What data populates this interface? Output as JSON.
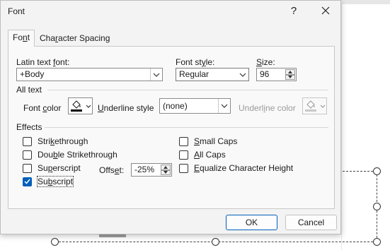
{
  "dialog": {
    "title": "Font",
    "help_label": "?",
    "tabs": [
      {
        "pre": "Fo",
        "key": "n",
        "post": "t"
      },
      {
        "pre": "Cha",
        "key": "r",
        "post": "acter Spacing"
      }
    ]
  },
  "font": {
    "latin_label": {
      "pre": "Latin text ",
      "key": "f",
      "post": "ont:"
    },
    "latin_value": "+Body",
    "style_label": {
      "pre": "Font st",
      "key": "y",
      "post": "le:"
    },
    "style_value": "Regular",
    "size_label": {
      "pre": "",
      "key": "S",
      "post": "ize:"
    },
    "size_value": "96"
  },
  "all_text": {
    "heading": "All text",
    "font_color_label": {
      "pre": "Font ",
      "key": "c",
      "post": "olor"
    },
    "underline_style_label": {
      "pre": "",
      "key": "U",
      "post": "nderline style"
    },
    "underline_style_value": "(none)",
    "underline_color_label": {
      "pre": "Underl",
      "key": "i",
      "post": "ne color"
    },
    "font_color_icon": "paint-bucket-icon",
    "font_color_swatch": "#000000",
    "underline_color_swatch": "#c8c8c8"
  },
  "effects": {
    "heading": "Effects",
    "strikethrough": {
      "pre": "Stri",
      "key": "k",
      "post": "ethrough",
      "checked": false
    },
    "double_strikethrough": {
      "pre": "Dou",
      "key": "b",
      "post": "le Strikethrough",
      "checked": false
    },
    "superscript": {
      "pre": "Su",
      "key": "p",
      "post": "erscript",
      "checked": false
    },
    "subscript": {
      "pre": "Su",
      "key": "b",
      "post": "script",
      "checked": true
    },
    "offset_label": {
      "pre": "Offs",
      "key": "e",
      "post": "t:"
    },
    "offset_value": "-25%",
    "small_caps": {
      "pre": "",
      "key": "S",
      "post": "mall Caps",
      "checked": false
    },
    "all_caps": {
      "pre": "",
      "key": "A",
      "post": "ll Caps",
      "checked": false
    },
    "equalize": {
      "pre": "",
      "key": "E",
      "post": "qualize Character Height",
      "checked": false
    }
  },
  "buttons": {
    "ok": "OK",
    "cancel": "Cancel"
  },
  "colors": {
    "accent": "#005fb8",
    "dialog_bg": "#f3f3f3"
  }
}
